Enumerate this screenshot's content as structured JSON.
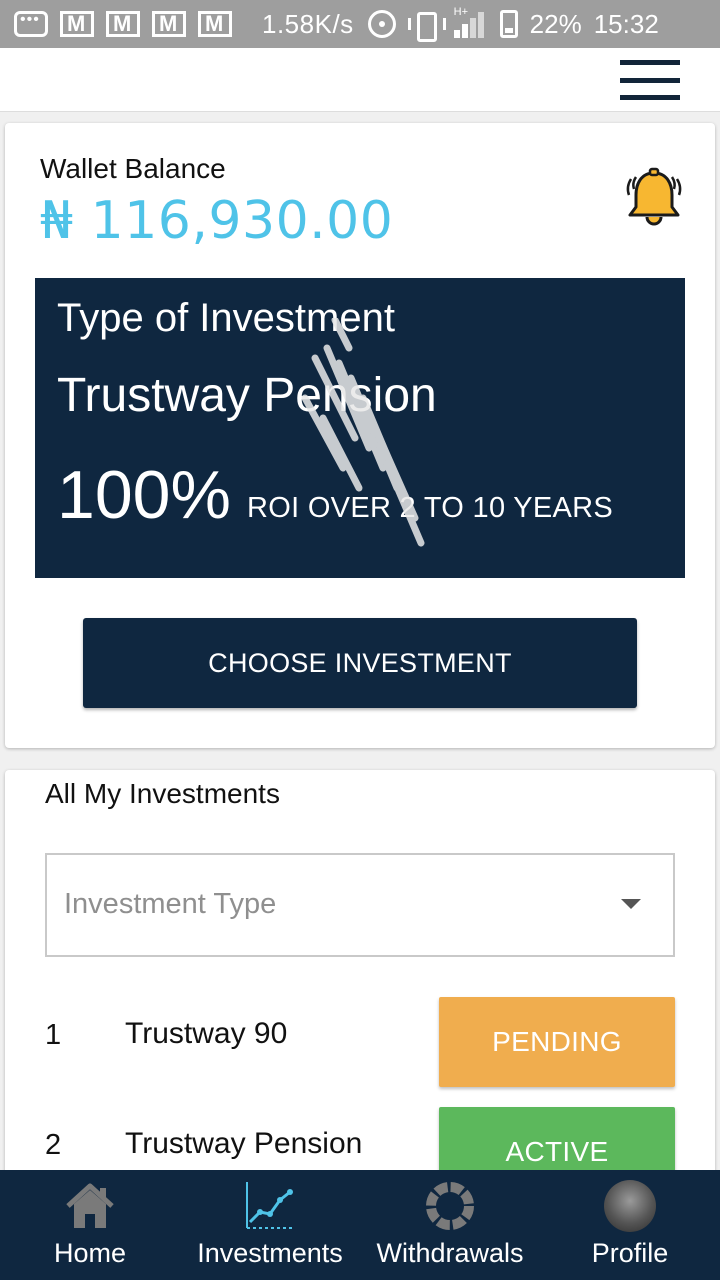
{
  "status_bar": {
    "speed": "1.58K/s",
    "network": "H+",
    "battery": "22%",
    "time": "15:32"
  },
  "wallet": {
    "label": "Wallet Balance",
    "amount": "₦ 116,930.00"
  },
  "investment_banner": {
    "type_label": "Type of Investment",
    "name": "Trustway Pension",
    "roi_percent": "100%",
    "roi_text": "ROI OVER 2 TO 10 YEARS"
  },
  "choose_button": "CHOOSE INVESTMENT",
  "investments": {
    "title": "All My Investments",
    "filter_placeholder": "Investment Type",
    "rows": [
      {
        "num": "1",
        "name": "Trustway 90",
        "status": "PENDING",
        "status_color": "#f0ad4e"
      },
      {
        "num": "2",
        "name": "Trustway Pension",
        "status": "ACTIVE",
        "status_color": "#5cb85c"
      }
    ]
  },
  "bottom_nav": {
    "items": [
      {
        "label": "Home",
        "icon": "home-icon"
      },
      {
        "label": "Investments",
        "icon": "chart-line-icon"
      },
      {
        "label": "Withdrawals",
        "icon": "ring-icon"
      },
      {
        "label": "Profile",
        "icon": "avatar"
      }
    ]
  },
  "colors": {
    "navy": "#0f2740",
    "wallet_amount": "#4fc3e8",
    "pending": "#f0ad4e",
    "active": "#5cb85c"
  }
}
